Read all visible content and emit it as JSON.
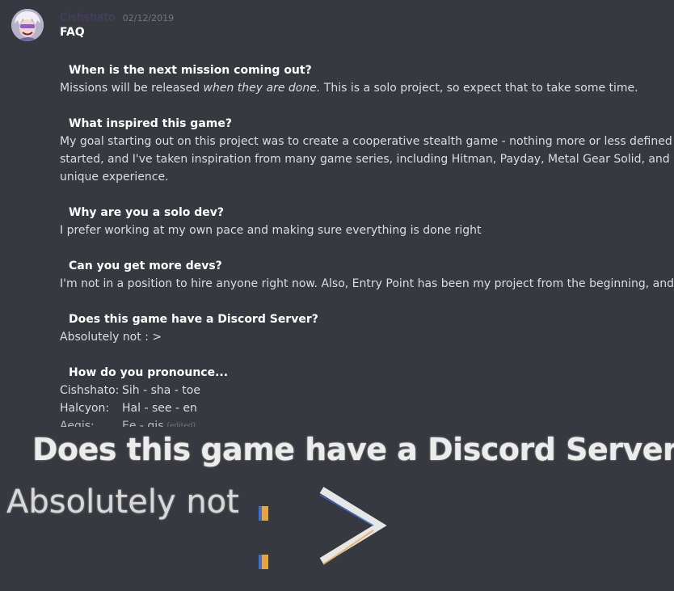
{
  "message": {
    "author": "Cishshato",
    "timestamp": "02/12/2019",
    "title": "FAQ",
    "faq": [
      {
        "question": "When is the next mission coming out?",
        "answer_before": "Missions will be released ",
        "answer_emphasis": "when they are done.",
        "answer_after": " This is a solo project, so expect that to take some time."
      },
      {
        "question": "What inspired this game?",
        "answer_lines": [
          "My goal starting out on this project was to create a cooperative stealth game - nothing more or less defined than th",
          "started, and I've taken inspiration from many game series, including Hitman, Payday, Metal Gear Solid, and Rainbow",
          "unique experience."
        ]
      },
      {
        "question": "Why are you a solo dev?",
        "answer": "I prefer working at my own pace and making sure everything is done right"
      },
      {
        "question": "Can you get more devs?",
        "answer": "I'm not in a position to hire anyone right now. Also, Entry Point has been my project from the beginning, and I'd like"
      },
      {
        "question": "Does this game have a Discord Server?",
        "answer": "Absolutely not : >"
      }
    ],
    "pronounce": {
      "question": "How do you pronounce...",
      "rows": [
        {
          "name": "Cishshato:",
          "sound": "Sih - sha - toe"
        },
        {
          "name": "Halcyon:",
          "sound": "Hal - see - en"
        }
      ],
      "cut_name": "Aegis:",
      "cut_sound": "Ee - gis",
      "edited": "(edited)"
    }
  },
  "zoomed": {
    "question": "Does this game have a Discord Server?",
    "answer": "Absolutely not"
  },
  "colors": {
    "background": "#36393f",
    "author": "#4a3f66",
    "timestamp": "#72767d",
    "text": "#dcddde",
    "heading": "#ffffff",
    "emote_orange": "#e8a33a",
    "emote_blue": "#3b6fd6"
  }
}
